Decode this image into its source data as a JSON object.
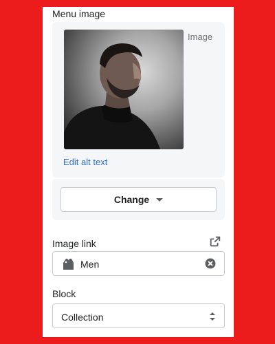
{
  "menu_image": {
    "label": "Menu image",
    "image_tag": "Image",
    "edit_alt_label": "Edit alt text",
    "change_label": "Change"
  },
  "image_link": {
    "label": "Image link",
    "value": "Men"
  },
  "block": {
    "label": "Block",
    "selected": "Collection"
  },
  "colors": {
    "background": "#ec1c1c",
    "panel": "#ffffff",
    "card": "#f4f6f8",
    "link": "#2c6ecb"
  },
  "icons": [
    "caret-down-icon",
    "external-link-icon",
    "tag-icon",
    "clear-icon",
    "select-arrows-icon"
  ]
}
